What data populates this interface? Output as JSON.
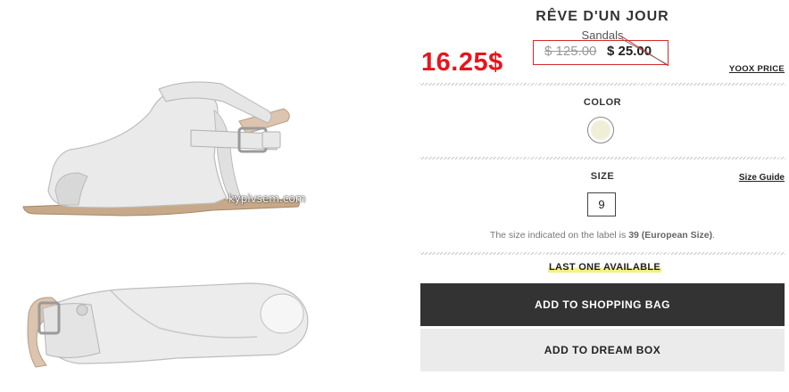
{
  "product": {
    "brand": "RÊVE D'UN JOUR",
    "category": "Sandals",
    "old_price": "$ 125.00",
    "new_price": "$ 25.00",
    "promo_price": "16.25$",
    "price_source_link": "YOOX PRICE"
  },
  "images": {
    "watermark": "kypivsem.com"
  },
  "color": {
    "label": "COLOR",
    "swatch_color": "#efefd8"
  },
  "size": {
    "label": "SIZE",
    "guide_link": "Size Guide",
    "selected": "9",
    "note_prefix": "The size indicated on the label is ",
    "note_bold": "39 (European Size)",
    "note_suffix": "."
  },
  "availability": "LAST ONE AVAILABLE",
  "actions": {
    "add_to_bag": "ADD TO SHOPPING BAG",
    "add_to_dream_box": "ADD TO DREAM BOX"
  },
  "colors": {
    "promo_red": "#e8141c",
    "bag_button": "#333333",
    "dream_button": "#ebebeb",
    "highlight": "#f4f08a"
  }
}
